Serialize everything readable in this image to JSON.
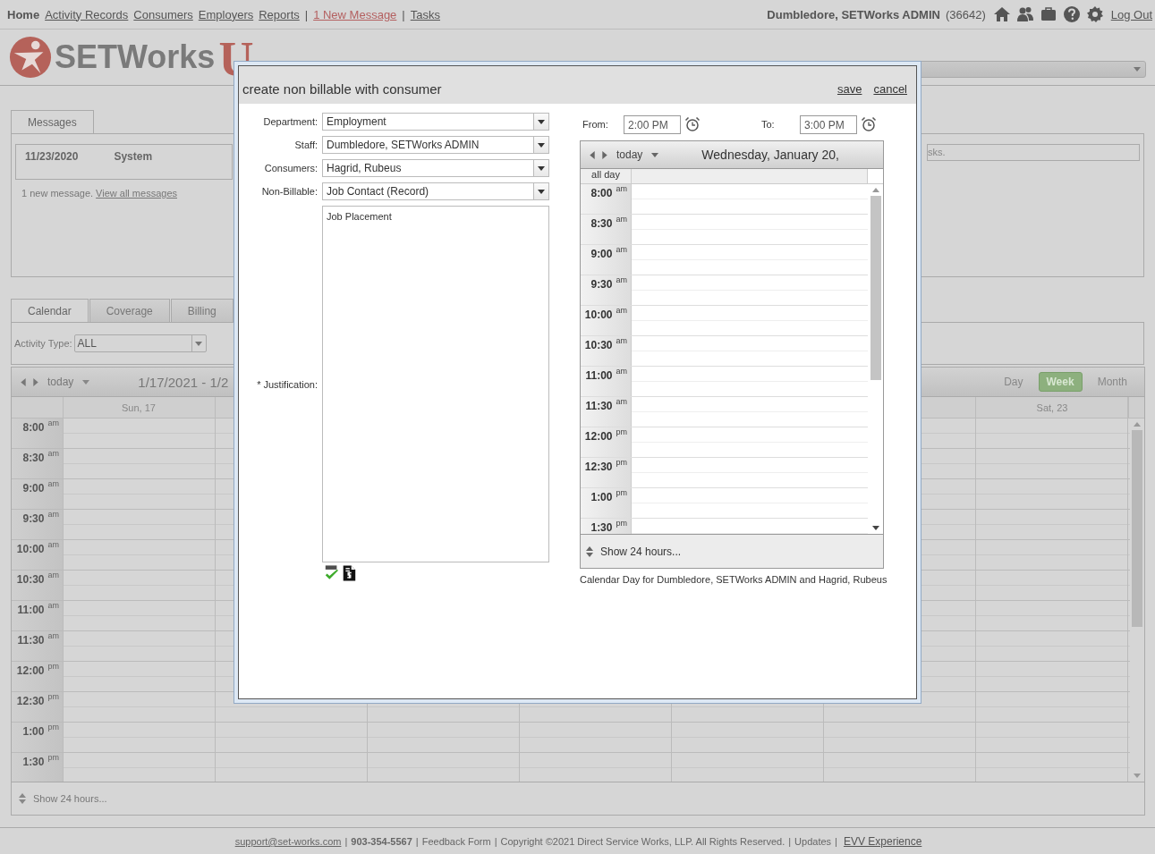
{
  "top_nav": {
    "items": [
      {
        "text": "Home",
        "kind": "current"
      },
      {
        "text": "Activity Records",
        "kind": "link"
      },
      {
        "text": "Consumers",
        "kind": "link"
      },
      {
        "text": "Employers",
        "kind": "link"
      },
      {
        "text": "Reports",
        "kind": "link"
      },
      {
        "text": "|",
        "kind": "separator"
      },
      {
        "text": "1 New Message",
        "kind": "alert"
      },
      {
        "text": "|",
        "kind": "separator"
      },
      {
        "text": "Tasks",
        "kind": "link"
      }
    ],
    "user": "Dumbledore, SETWorks ADMIN",
    "user_id": "(36642)",
    "logout": "Log Out"
  },
  "logo": {
    "name": "SETWorks",
    "suffix": "U"
  },
  "messages": {
    "tabs": [
      {
        "label": "Messages",
        "selected": true
      }
    ],
    "items": [
      {
        "date": "11/23/2020",
        "from": "System"
      }
    ],
    "summary": "1 new message.",
    "link": "View all messages",
    "tasks_text": "sks."
  },
  "calendar": {
    "tabs": [
      {
        "label": "Calendar",
        "selected": true
      },
      {
        "label": "Coverage",
        "selected": false
      },
      {
        "label": "Billing",
        "selected": false
      }
    ],
    "filter": {
      "label": "Activity Type:",
      "value": "ALL"
    },
    "today": "today",
    "range": "1/17/2021 - 1/2",
    "views": [
      {
        "label": "Day",
        "selected": false
      },
      {
        "label": "Week",
        "selected": true
      },
      {
        "label": "Month",
        "selected": false
      }
    ],
    "days": [
      "Sun, 17",
      "Sat, 23"
    ],
    "slots": [
      {
        "time": "8:00",
        "period": "am"
      },
      {
        "time": "8:30",
        "period": "am"
      },
      {
        "time": "9:00",
        "period": "am"
      },
      {
        "time": "9:30",
        "period": "am"
      },
      {
        "time": "10:00",
        "period": "am"
      },
      {
        "time": "10:30",
        "period": "am"
      },
      {
        "time": "11:00",
        "period": "am"
      },
      {
        "time": "11:30",
        "period": "am"
      },
      {
        "time": "12:00",
        "period": "pm"
      },
      {
        "time": "12:30",
        "period": "pm"
      },
      {
        "time": "1:00",
        "period": "pm"
      },
      {
        "time": "1:30",
        "period": "pm"
      }
    ],
    "show_all": "Show 24 hours..."
  },
  "dialog": {
    "title": "create non billable with consumer",
    "actions": [
      "save",
      "cancel"
    ],
    "fields": [
      {
        "label": "Department:",
        "value": "Employment"
      },
      {
        "label": "Staff:",
        "value": "Dumbledore, SETWorks ADMIN"
      },
      {
        "label": "Consumers:",
        "value": "Hagrid, Rubeus"
      },
      {
        "label": "Non-Billable:",
        "value": "Job Contact (Record)"
      }
    ],
    "justification": {
      "label": "* Justification:",
      "value": "Job Placement"
    },
    "from": {
      "label": "From:",
      "value": "2:00 PM"
    },
    "to": {
      "label": "To:",
      "value": "3:00 PM"
    },
    "day_calendar": {
      "today": "today",
      "title": "Wednesday, January 20,",
      "all_day": "all day",
      "slots": [
        {
          "time": "8:00",
          "period": "am"
        },
        {
          "time": "8:30",
          "period": "am"
        },
        {
          "time": "9:00",
          "period": "am"
        },
        {
          "time": "9:30",
          "period": "am"
        },
        {
          "time": "10:00",
          "period": "am"
        },
        {
          "time": "10:30",
          "period": "am"
        },
        {
          "time": "11:00",
          "period": "am"
        },
        {
          "time": "11:30",
          "period": "am"
        },
        {
          "time": "12:00",
          "period": "pm"
        },
        {
          "time": "12:30",
          "period": "pm"
        },
        {
          "time": "1:00",
          "period": "pm"
        },
        {
          "time": "1:30",
          "period": "pm"
        }
      ],
      "show_all": "Show 24 hours..."
    },
    "caption": "Calendar Day for Dumbledore, SETWorks ADMIN and Hagrid, Rubeus"
  },
  "footer": {
    "items": [
      {
        "text": "support@set-works.com",
        "kind": "link"
      },
      {
        "text": "|",
        "kind": "separator"
      },
      {
        "text": "903-354-5567",
        "kind": "bold"
      },
      {
        "text": "|",
        "kind": "separator"
      },
      {
        "text": "Feedback Form",
        "kind": "plain"
      },
      {
        "text": "|",
        "kind": "separator"
      },
      {
        "text": "Copyright ©2021 Direct Service Works, LLP. All Rights Reserved.",
        "kind": "plain"
      },
      {
        "text": "|",
        "kind": "separator"
      },
      {
        "text": "Updates",
        "kind": "plain"
      },
      {
        "text": "|",
        "kind": "separator"
      },
      {
        "text": "EVV Experience",
        "kind": "feature"
      }
    ]
  }
}
